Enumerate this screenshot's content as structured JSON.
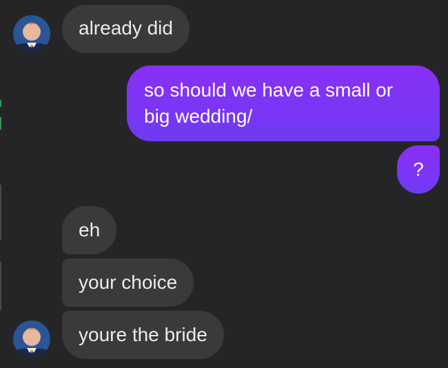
{
  "conversation": {
    "messages": [
      {
        "id": "m1",
        "direction": "incoming",
        "text": "already did"
      },
      {
        "id": "m2",
        "direction": "outgoing",
        "text": "so should we have a small or big wedding/"
      },
      {
        "id": "m3",
        "direction": "outgoing",
        "text": "?"
      },
      {
        "id": "m4",
        "direction": "incoming",
        "text": "eh"
      },
      {
        "id": "m5",
        "direction": "incoming",
        "text": "your choice"
      },
      {
        "id": "m6",
        "direction": "incoming",
        "text": "youre the bride"
      }
    ]
  },
  "colors": {
    "background": "#252527",
    "incoming_bubble": "#3a3a3c",
    "outgoing_bubble_top": "#8a2ff5",
    "outgoing_bubble_bottom": "#6f3af3",
    "incoming_text": "#ececef",
    "outgoing_text": "#ffffff"
  },
  "avatar": {
    "icon": "profile-photo-icon"
  }
}
